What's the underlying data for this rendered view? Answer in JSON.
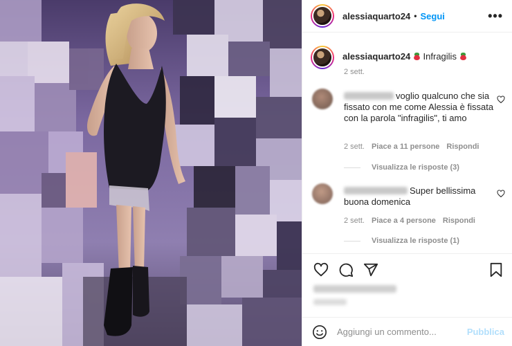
{
  "post": {
    "username": "alessiaquarto24",
    "follow_label": "Segui",
    "separator": "•",
    "more_label": "•••",
    "caption_text": "Infragilis",
    "caption_time": "2 sett."
  },
  "comments": [
    {
      "text": "voglio qualcuno che sia fissato con me come Alessia è fissata con la parola \"infragilis\", ti amo",
      "time": "2 sett.",
      "likes": "Piace a 11 persone",
      "reply_label": "Rispondi",
      "view_replies": "Visualizza le risposte (3)"
    },
    {
      "text": "Super bellissima buona domenica",
      "time": "2 sett.",
      "likes": "Piace a 4 persone",
      "reply_label": "Rispondi",
      "view_replies": "Visualizza le risposte (1)"
    }
  ],
  "actions": {
    "like_icon": "heart-icon",
    "comment_icon": "comment-icon",
    "share_icon": "share-icon",
    "save_icon": "bookmark-icon"
  },
  "add_comment": {
    "placeholder": "Aggiungi un commento...",
    "publish_label": "Pubblica",
    "emoji_icon": "smiley-icon"
  },
  "colors": {
    "link_blue": "#0095f6",
    "publish_disabled": "#b2dffc",
    "muted_text": "#8e8e8e",
    "divider": "#efefef"
  }
}
